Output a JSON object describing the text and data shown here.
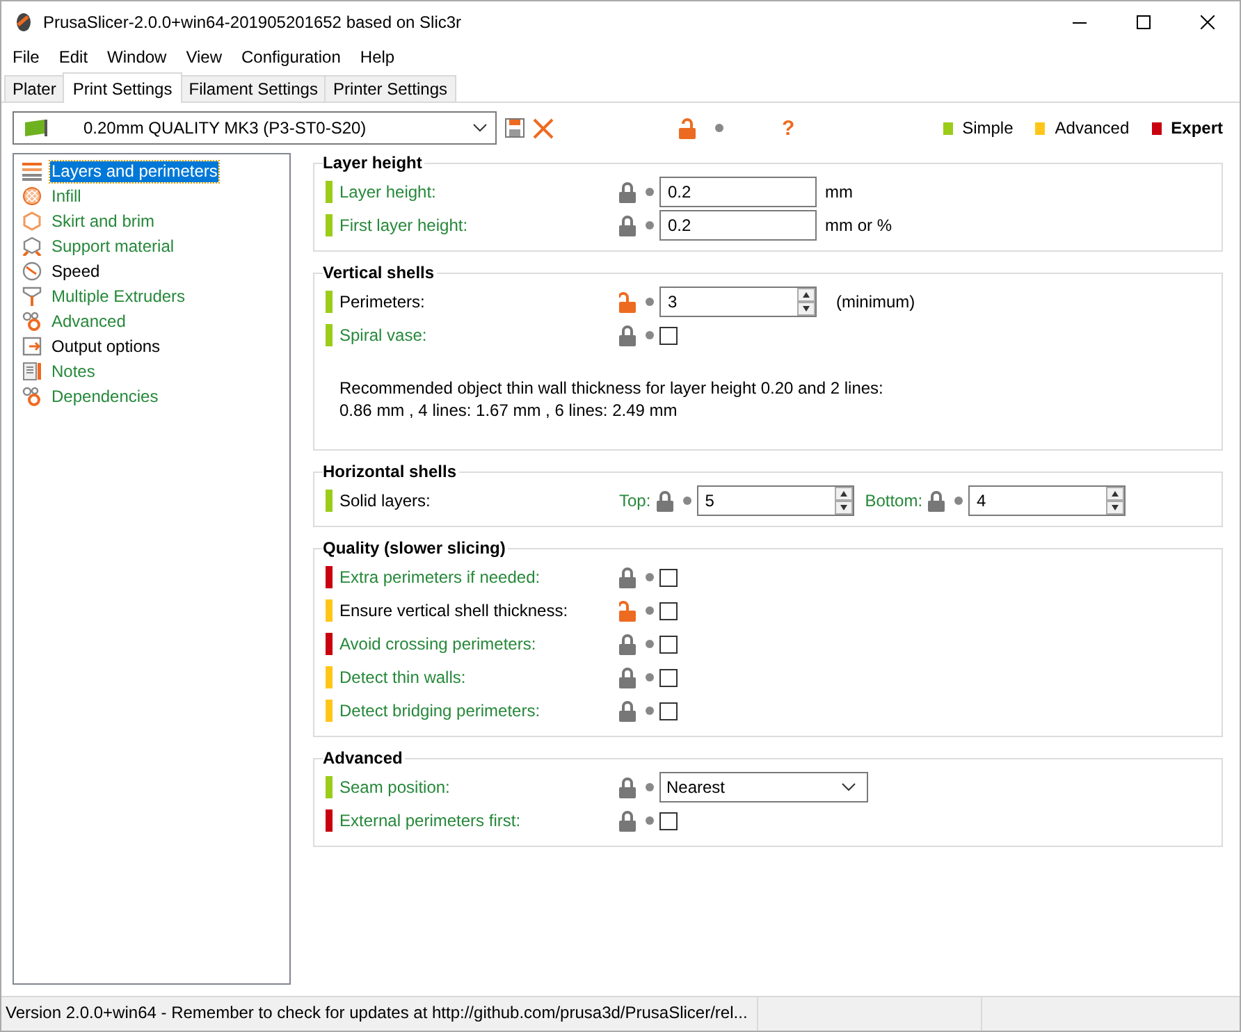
{
  "window": {
    "title": "PrusaSlicer-2.0.0+win64-201905201652 based on Slic3r"
  },
  "menu": [
    "File",
    "Edit",
    "Window",
    "View",
    "Configuration",
    "Help"
  ],
  "tabs": [
    {
      "label": "Plater",
      "selected": false
    },
    {
      "label": "Print Settings",
      "selected": true
    },
    {
      "label": "Filament Settings",
      "selected": false
    },
    {
      "label": "Printer Settings",
      "selected": false
    }
  ],
  "toolbar": {
    "preset": "0.20mm QUALITY MK3 (P3-ST0-S20)",
    "locked": false,
    "help": "?"
  },
  "modes": [
    {
      "label": "Simple",
      "color": "#9ccc1a",
      "selected": false
    },
    {
      "label": "Advanced",
      "color": "#ffc619",
      "selected": false
    },
    {
      "label": "Expert",
      "color": "#c8000f",
      "selected": true
    }
  ],
  "sidebar": {
    "items": [
      {
        "label": "Layers and perimeters",
        "selected": true,
        "system": false
      },
      {
        "label": "Infill",
        "selected": false,
        "system": true
      },
      {
        "label": "Skirt and brim",
        "selected": false,
        "system": true
      },
      {
        "label": "Support material",
        "selected": false,
        "system": true
      },
      {
        "label": "Speed",
        "selected": false,
        "system": false
      },
      {
        "label": "Multiple Extruders",
        "selected": false,
        "system": true
      },
      {
        "label": "Advanced",
        "selected": false,
        "system": true
      },
      {
        "label": "Output options",
        "selected": false,
        "system": false
      },
      {
        "label": "Notes",
        "selected": false,
        "system": true
      },
      {
        "label": "Dependencies",
        "selected": false,
        "system": true
      }
    ]
  },
  "sections": [
    {
      "title": "Layer height",
      "rows": [
        {
          "kind": "text",
          "color": "#9ccc1a",
          "label": "Layer height:",
          "system": true,
          "locked": true,
          "value": "0.2",
          "unit": "mm"
        },
        {
          "kind": "text",
          "color": "#9ccc1a",
          "label": "First layer height:",
          "system": true,
          "locked": true,
          "value": "0.2",
          "unit": "mm or %"
        }
      ]
    },
    {
      "title": "Vertical shells",
      "rows": [
        {
          "kind": "spin",
          "color": "#9ccc1a",
          "label": "Perimeters:",
          "system": false,
          "locked": false,
          "value": "3",
          "unit": "(minimum)"
        },
        {
          "kind": "checkbox",
          "color": "#9ccc1a",
          "label": "Spiral vase:",
          "system": true,
          "locked": true,
          "checked": false
        },
        {
          "kind": "note",
          "text": "Recommended object thin wall thickness for layer height 0.20 and 2 lines:\n0.86 mm , 4 lines: 1.67 mm , 6 lines: 2.49 mm"
        }
      ]
    },
    {
      "title": "Horizontal shells",
      "rows": [
        {
          "kind": "pair",
          "color": "#9ccc1a",
          "label": "Solid layers:",
          "system": false,
          "parts": [
            {
              "label": "Top:",
              "system": true,
              "locked": true,
              "value": "5"
            },
            {
              "label": "Bottom:",
              "system": true,
              "locked": true,
              "value": "4"
            }
          ]
        }
      ]
    },
    {
      "title": "Quality (slower slicing)",
      "rows": [
        {
          "kind": "checkbox",
          "color": "#c8000f",
          "label": "Extra perimeters if needed:",
          "system": true,
          "locked": true,
          "checked": false
        },
        {
          "kind": "checkbox",
          "color": "#ffc619",
          "label": "Ensure vertical shell thickness:",
          "system": false,
          "locked": false,
          "checked": false
        },
        {
          "kind": "checkbox",
          "color": "#c8000f",
          "label": "Avoid crossing perimeters:",
          "system": true,
          "locked": true,
          "checked": false
        },
        {
          "kind": "checkbox",
          "color": "#ffc619",
          "label": "Detect thin walls:",
          "system": true,
          "locked": true,
          "checked": false
        },
        {
          "kind": "checkbox",
          "color": "#ffc619",
          "label": "Detect bridging perimeters:",
          "system": true,
          "locked": true,
          "checked": false
        }
      ]
    },
    {
      "title": "Advanced",
      "rows": [
        {
          "kind": "select",
          "color": "#9ccc1a",
          "label": "Seam position:",
          "system": true,
          "locked": true,
          "value": "Nearest"
        },
        {
          "kind": "checkbox",
          "color": "#c8000f",
          "label": "External perimeters first:",
          "system": true,
          "locked": true,
          "checked": false
        }
      ]
    }
  ],
  "status_bar": {
    "text": "Version 2.0.0+win64 - Remember to check for updates at http://github.com/prusa3d/PrusaSlicer/rel..."
  }
}
